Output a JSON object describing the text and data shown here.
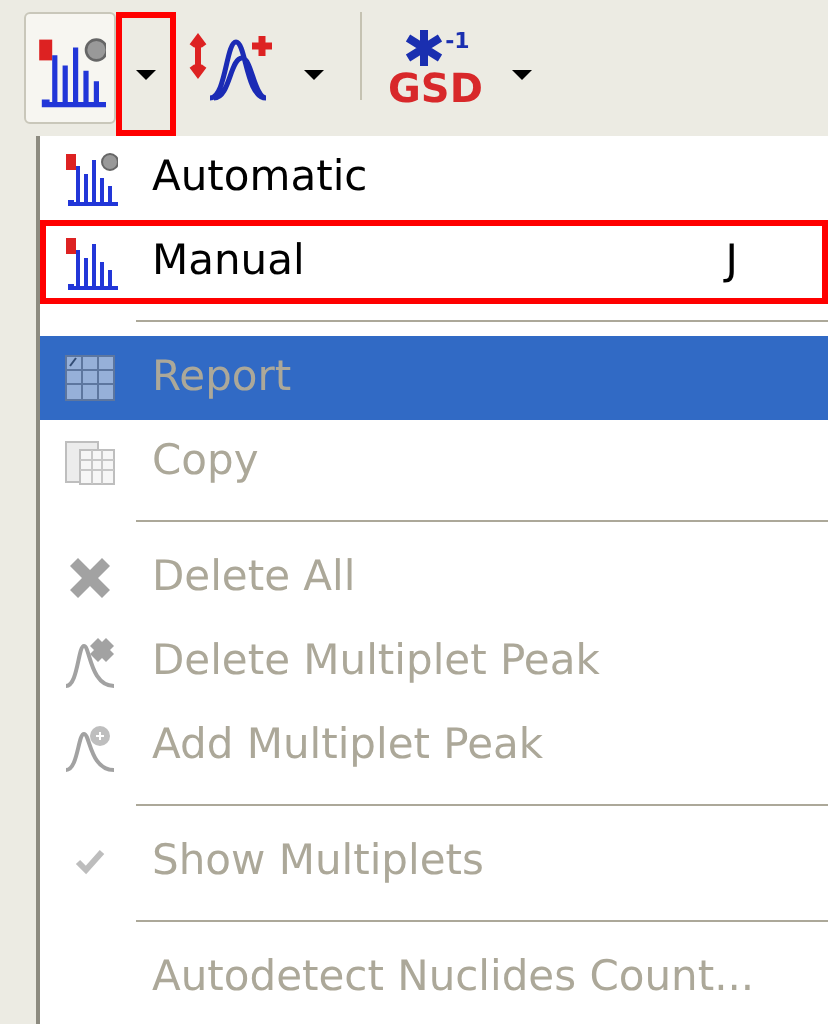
{
  "toolbar": {
    "buttons": [
      {
        "kind": "spectrum",
        "open": true,
        "dropdown_highlighted": true
      },
      {
        "kind": "peaks",
        "open": false,
        "dropdown_highlighted": false
      },
      {
        "kind": "gsd",
        "open": false,
        "dropdown_highlighted": false,
        "label": "GSD",
        "superscript": "-1"
      }
    ]
  },
  "menu": {
    "items": [
      {
        "kind": "item",
        "label": "Automatic",
        "disabled": false,
        "selected": false,
        "highlighted": false
      },
      {
        "kind": "item",
        "label": "Manual",
        "shortcut": "J",
        "disabled": false,
        "selected": false,
        "highlighted": true
      },
      {
        "kind": "separator"
      },
      {
        "kind": "item",
        "label": "Report",
        "disabled": true,
        "selected": true,
        "highlighted": false
      },
      {
        "kind": "item",
        "label": "Copy",
        "disabled": true,
        "selected": false,
        "highlighted": false
      },
      {
        "kind": "separator"
      },
      {
        "kind": "item",
        "label": "Delete All",
        "disabled": true,
        "selected": false,
        "highlighted": false
      },
      {
        "kind": "item",
        "label": "Delete Multiplet Peak",
        "disabled": true,
        "selected": false,
        "highlighted": false
      },
      {
        "kind": "item",
        "label": "Add Multiplet Peak",
        "disabled": true,
        "selected": false,
        "highlighted": false
      },
      {
        "kind": "separator"
      },
      {
        "kind": "check",
        "label": "Show Multiplets",
        "checked": true,
        "disabled": true,
        "selected": false,
        "highlighted": false
      },
      {
        "kind": "separator"
      },
      {
        "kind": "item",
        "label": "Autodetect Nuclides Count...",
        "disabled": true,
        "selected": false,
        "highlighted": false
      }
    ]
  }
}
